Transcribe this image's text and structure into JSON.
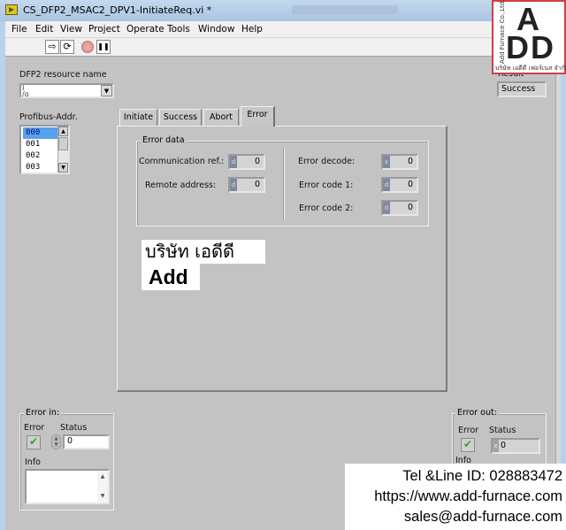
{
  "window": {
    "title": "CS_DFP2_MSAC2_DPV1-InitiateReq.vi *",
    "app_icon": "labview-vi-icon"
  },
  "menu": [
    "File",
    "Edit",
    "View",
    "Project",
    "Operate",
    "Tools",
    "Window",
    "Help"
  ],
  "toolbar": {
    "run": "run-arrow-icon",
    "run_continuously": "run-continuously-icon",
    "abort": "abort-stop-icon",
    "pause": "pause-icon",
    "run_glyph": "⇨",
    "run_cont_glyph": "⟳",
    "pause_glyph": "❚❚"
  },
  "controls": {
    "resource_label": "DFP2 resource name",
    "resource_value": "",
    "resource_prefix": "I/O",
    "profibus_label": "Profibus-Addr.",
    "profibus_items": [
      "000",
      "001",
      "002",
      "003"
    ],
    "profibus_selected": "000",
    "result_label": "Result",
    "result_value": "Success"
  },
  "tabs": {
    "items": [
      "Initiate",
      "Success",
      "Abort",
      "Error"
    ],
    "active": "Error"
  },
  "error_data": {
    "group_title": "Error data",
    "fields": [
      {
        "label": "Communication ref.:",
        "radix": "d",
        "value": "0"
      },
      {
        "label": "Remote address:",
        "radix": "d",
        "value": "0"
      },
      {
        "label": "Error decode:",
        "radix": "x",
        "value": "0"
      },
      {
        "label": "Error code 1:",
        "radix": "d",
        "value": "0"
      },
      {
        "label": "Error code 2:",
        "radix": "d",
        "value": "0"
      }
    ]
  },
  "error_in": {
    "title": "Error in:",
    "error_label": "Error",
    "status_label": "Status",
    "status_value": "0",
    "info_label": "Info",
    "info_value": ""
  },
  "error_out": {
    "title": "Error out:",
    "error_label": "Error",
    "status_label": "Status",
    "status_radix": "x",
    "status_value": "0",
    "info_label": "Info"
  },
  "watermark": {
    "thai": "บริษัท เอดีดี",
    "add": "Add",
    "logo_letters_top": "A",
    "logo_letters_bottom": "DD",
    "logo_vertical": "Add Furnace Co.,Ltd.",
    "logo_thai": "บริษัท เอดีดี เฟอร์เนส จำกัด",
    "contact_lines": [
      "Tel &Line ID: 028883472",
      "https://www.add-furnace.com",
      "sales@add-furnace.com"
    ]
  },
  "colors": {
    "panel_bg": "#c3c3c3",
    "selection": "#5aa0f0",
    "check_green": "#2aa72a",
    "logo_border": "#d04040"
  }
}
